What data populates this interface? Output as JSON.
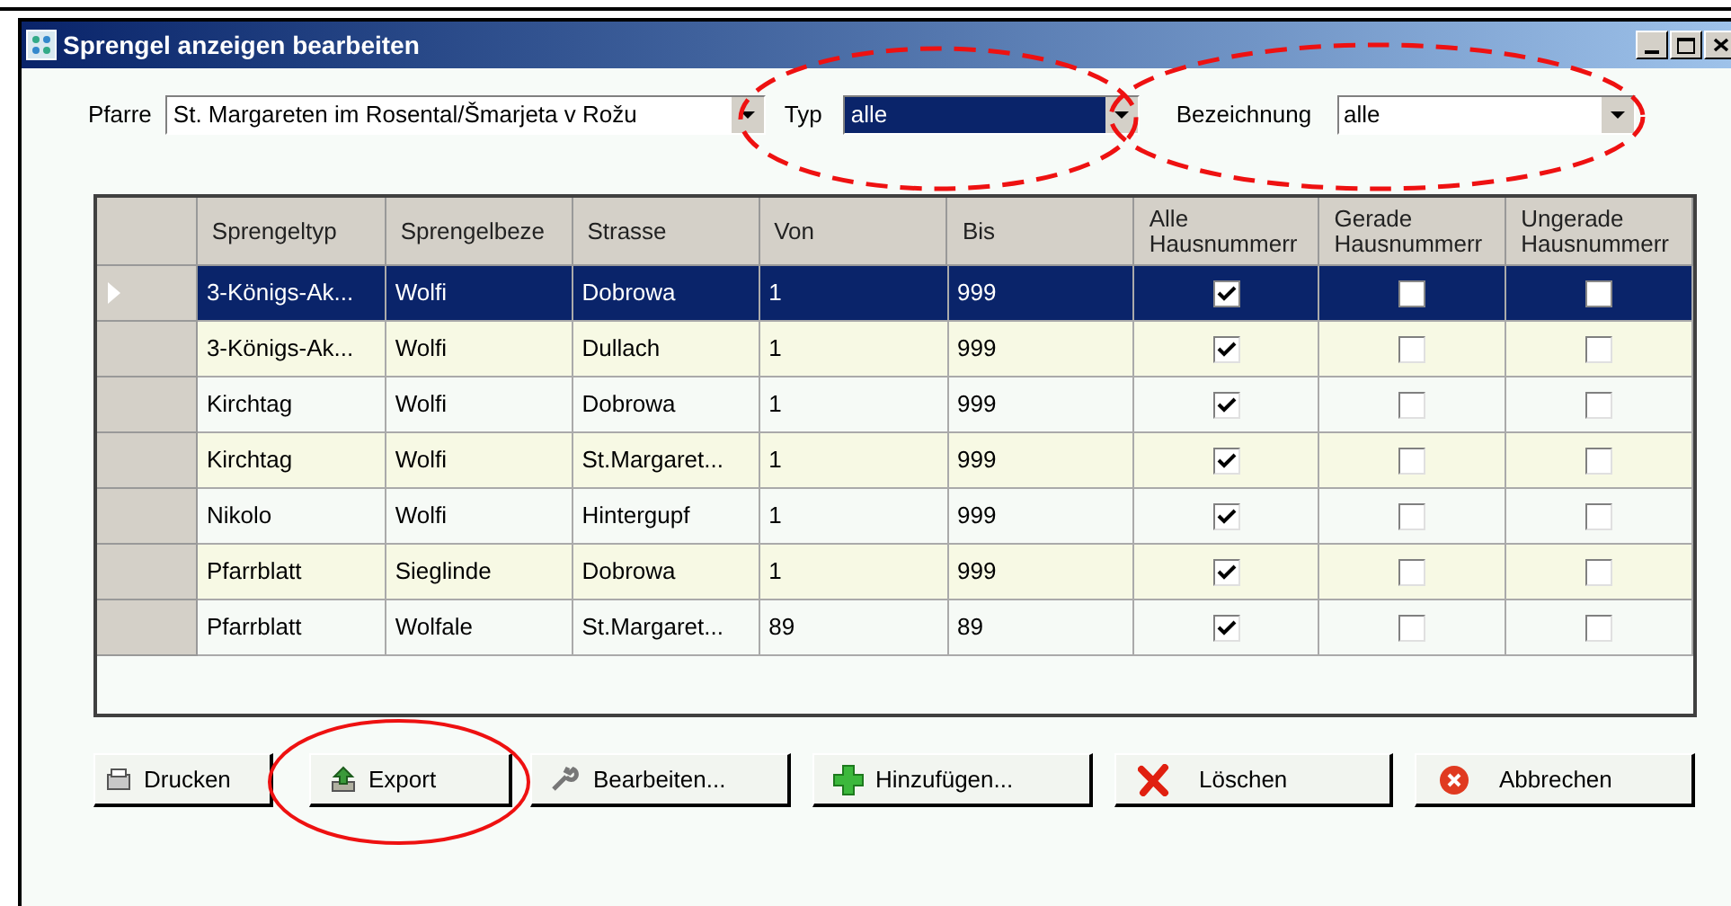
{
  "window": {
    "title": "Sprengel anzeigen bearbeiten"
  },
  "filters": [
    {
      "label": "Pfarre",
      "value": "St. Margareten im Rosental/Šmarjeta v Rožu",
      "selected": false,
      "circled": false
    },
    {
      "label": "Typ",
      "value": "alle",
      "selected": true,
      "circled": true
    },
    {
      "label": "Bezeichnung",
      "value": "alle",
      "selected": false,
      "circled": true
    }
  ],
  "table": {
    "columns": [
      "Sprengeltyp",
      "Sprengelbeze",
      "Strasse",
      "Von",
      "Bis",
      "Alle Hausnummerr",
      "Gerade Hausnummerr",
      "Ungerade Hausnummerr"
    ],
    "rows": [
      {
        "selected": true,
        "cells": [
          "3-Königs-Ak...",
          "Wolfi",
          "Dobrowa",
          "1",
          "999"
        ],
        "checks": [
          true,
          false,
          false
        ]
      },
      {
        "selected": false,
        "cells": [
          "3-Königs-Ak...",
          "Wolfi",
          "Dullach",
          "1",
          "999"
        ],
        "checks": [
          true,
          false,
          false
        ]
      },
      {
        "selected": false,
        "cells": [
          "Kirchtag",
          "Wolfi",
          "Dobrowa",
          "1",
          "999"
        ],
        "checks": [
          true,
          false,
          false
        ]
      },
      {
        "selected": false,
        "cells": [
          "Kirchtag",
          "Wolfi",
          "St.Margaret...",
          "1",
          "999"
        ],
        "checks": [
          true,
          false,
          false
        ]
      },
      {
        "selected": false,
        "cells": [
          "Nikolo",
          "Wolfi",
          "Hintergupf",
          "1",
          "999"
        ],
        "checks": [
          true,
          false,
          false
        ]
      },
      {
        "selected": false,
        "cells": [
          "Pfarrblatt",
          "Sieglinde",
          "Dobrowa",
          "1",
          "999"
        ],
        "checks": [
          true,
          false,
          false
        ]
      },
      {
        "selected": false,
        "cells": [
          "Pfarrblatt",
          "Wolfale",
          "St.Margaret...",
          "89",
          "89"
        ],
        "checks": [
          true,
          false,
          false
        ]
      }
    ]
  },
  "buttons": [
    {
      "label": "Drucken",
      "kind": "print",
      "circled": false
    },
    {
      "label": "Export",
      "kind": "export",
      "circled": true
    },
    {
      "label": "Bearbeiten...",
      "kind": "edit",
      "circled": false
    },
    {
      "label": "Hinzufügen...",
      "kind": "add",
      "circled": false
    },
    {
      "label": "Löschen",
      "kind": "delete",
      "circled": false
    },
    {
      "label": "Abbrechen",
      "kind": "cancel",
      "circled": false
    }
  ]
}
